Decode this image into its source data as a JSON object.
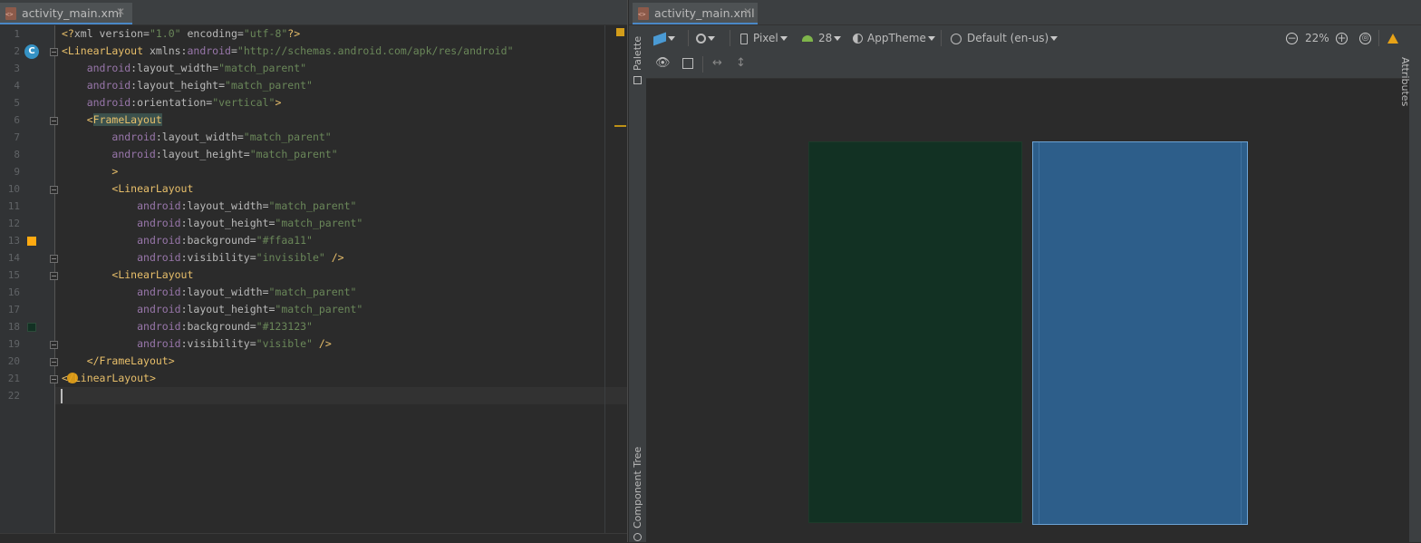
{
  "editor": {
    "tab_name": "activity_main.xml",
    "line_numbers": [
      "1",
      "2",
      "3",
      "4",
      "5",
      "6",
      "7",
      "8",
      "9",
      "10",
      "11",
      "12",
      "13",
      "14",
      "15",
      "16",
      "17",
      "18",
      "19",
      "20",
      "21",
      "22"
    ],
    "lines": [
      [
        {
          "t": "<?",
          "c": "tg"
        },
        {
          "t": "xml version=",
          "c": "an"
        },
        {
          "t": "\"1.0\"",
          "c": "av"
        },
        {
          "t": " encoding=",
          "c": "an"
        },
        {
          "t": "\"utf-8\"",
          "c": "av"
        },
        {
          "t": "?>",
          "c": "tg"
        }
      ],
      [
        {
          "t": "<LinearLayout ",
          "c": "tg"
        },
        {
          "t": "xmlns:",
          "c": "an"
        },
        {
          "t": "android",
          "c": "ns"
        },
        {
          "t": "=",
          "c": "an"
        },
        {
          "t": "\"http://schemas.android.com/apk/res/android\"",
          "c": "av"
        }
      ],
      [
        {
          "t": "    ",
          "c": "pl"
        },
        {
          "t": "android",
          "c": "ns"
        },
        {
          "t": ":layout_width=",
          "c": "an"
        },
        {
          "t": "\"match_parent\"",
          "c": "av"
        }
      ],
      [
        {
          "t": "    ",
          "c": "pl"
        },
        {
          "t": "android",
          "c": "ns"
        },
        {
          "t": ":layout_height=",
          "c": "an"
        },
        {
          "t": "\"match_parent\"",
          "c": "av"
        }
      ],
      [
        {
          "t": "    ",
          "c": "pl"
        },
        {
          "t": "android",
          "c": "ns"
        },
        {
          "t": ":orientation=",
          "c": "an"
        },
        {
          "t": "\"vertical\"",
          "c": "av"
        },
        {
          "t": ">",
          "c": "tg"
        }
      ],
      [
        {
          "t": "    ",
          "c": "pl"
        },
        {
          "t": "<",
          "c": "tg"
        },
        {
          "t": "FrameLayout",
          "c": "hl"
        }
      ],
      [
        {
          "t": "        ",
          "c": "pl"
        },
        {
          "t": "android",
          "c": "ns"
        },
        {
          "t": ":layout_width=",
          "c": "an"
        },
        {
          "t": "\"match_parent\"",
          "c": "av"
        }
      ],
      [
        {
          "t": "        ",
          "c": "pl"
        },
        {
          "t": "android",
          "c": "ns"
        },
        {
          "t": ":layout_height=",
          "c": "an"
        },
        {
          "t": "\"match_parent\"",
          "c": "av"
        }
      ],
      [
        {
          "t": "        ",
          "c": "pl"
        },
        {
          "t": ">",
          "c": "tg"
        }
      ],
      [
        {
          "t": "        ",
          "c": "pl"
        },
        {
          "t": "<LinearLayout",
          "c": "tg"
        }
      ],
      [
        {
          "t": "            ",
          "c": "pl"
        },
        {
          "t": "android",
          "c": "ns"
        },
        {
          "t": ":layout_width=",
          "c": "an"
        },
        {
          "t": "\"match_parent\"",
          "c": "av"
        }
      ],
      [
        {
          "t": "            ",
          "c": "pl"
        },
        {
          "t": "android",
          "c": "ns"
        },
        {
          "t": ":layout_height=",
          "c": "an"
        },
        {
          "t": "\"match_parent\"",
          "c": "av"
        }
      ],
      [
        {
          "t": "            ",
          "c": "pl"
        },
        {
          "t": "android",
          "c": "ns"
        },
        {
          "t": ":background=",
          "c": "an"
        },
        {
          "t": "\"#ffaa11\"",
          "c": "av"
        }
      ],
      [
        {
          "t": "            ",
          "c": "pl"
        },
        {
          "t": "android",
          "c": "ns"
        },
        {
          "t": ":visibility=",
          "c": "an"
        },
        {
          "t": "\"invisible\"",
          "c": "av"
        },
        {
          "t": " />",
          "c": "tg"
        }
      ],
      [
        {
          "t": "        ",
          "c": "pl"
        },
        {
          "t": "<LinearLayout",
          "c": "tg"
        }
      ],
      [
        {
          "t": "            ",
          "c": "pl"
        },
        {
          "t": "android",
          "c": "ns"
        },
        {
          "t": ":layout_width=",
          "c": "an"
        },
        {
          "t": "\"match_parent\"",
          "c": "av"
        }
      ],
      [
        {
          "t": "            ",
          "c": "pl"
        },
        {
          "t": "android",
          "c": "ns"
        },
        {
          "t": ":layout_height=",
          "c": "an"
        },
        {
          "t": "\"match_parent\"",
          "c": "av"
        }
      ],
      [
        {
          "t": "            ",
          "c": "pl"
        },
        {
          "t": "android",
          "c": "ns"
        },
        {
          "t": ":background=",
          "c": "an"
        },
        {
          "t": "\"#123123\"",
          "c": "av"
        }
      ],
      [
        {
          "t": "            ",
          "c": "pl"
        },
        {
          "t": "android",
          "c": "ns"
        },
        {
          "t": ":visibility=",
          "c": "an"
        },
        {
          "t": "\"visible\"",
          "c": "av"
        },
        {
          "t": " />",
          "c": "tg"
        }
      ],
      [
        {
          "t": "    ",
          "c": "pl"
        },
        {
          "t": "</FrameLayout>",
          "c": "tg"
        }
      ],
      [
        {
          "t": "</",
          "c": "tg"
        },
        {
          "t": "LinearLayout>",
          "c": "tg"
        }
      ],
      [
        {
          "t": "",
          "c": "pl"
        }
      ]
    ],
    "gutter_colors": {
      "line13": "#ffaa11",
      "line18": "#123123"
    }
  },
  "design": {
    "tab_name": "activity_main.xml",
    "palette_label": "Palette",
    "component_tree_label": "Component Tree",
    "attributes_label": "Attributes",
    "device": "Pixel",
    "api_level": "28",
    "theme": "AppTheme",
    "locale": "Default (en-us)",
    "zoom": "22%",
    "preview_colors": {
      "design": "#123123",
      "blueprint": "#2d5e8a"
    }
  },
  "colors": {
    "accent": "#4a88c7",
    "warning": "#d39d1a"
  }
}
